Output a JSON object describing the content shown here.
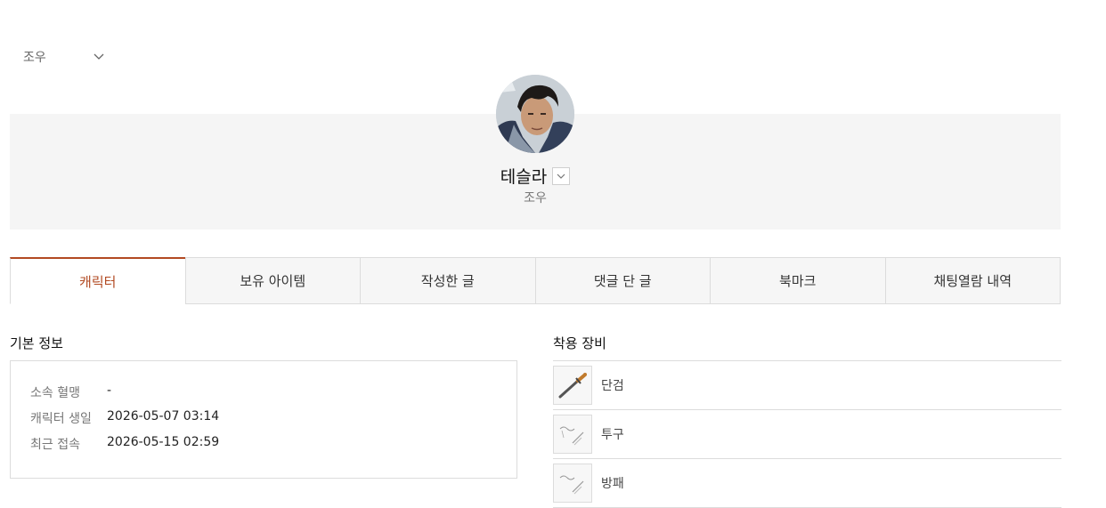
{
  "server_select": {
    "value": "조우"
  },
  "profile": {
    "name": "테슬라",
    "class": "조우"
  },
  "tabs": [
    {
      "label": "캐릭터",
      "active": true
    },
    {
      "label": "보유 아이템",
      "active": false
    },
    {
      "label": "작성한 글",
      "active": false
    },
    {
      "label": "댓글 단 글",
      "active": false
    },
    {
      "label": "북마크",
      "active": false
    },
    {
      "label": "채팅열람 내역",
      "active": false
    }
  ],
  "basic_info": {
    "title": "기본 정보",
    "rows": [
      {
        "label": "소속 혈맹",
        "value": "-"
      },
      {
        "label": "캐릭터 생일",
        "value": "2026-05-07 03:14"
      },
      {
        "label": "최근 접속",
        "value": "2026-05-15 02:59"
      }
    ]
  },
  "equipment": {
    "title": "착용 장비",
    "items": [
      {
        "name": "단검",
        "icon": "dagger-icon"
      },
      {
        "name": "투구",
        "icon": "placeholder-icon"
      },
      {
        "name": "방패",
        "icon": "placeholder-icon"
      }
    ]
  },
  "colors": {
    "accent": "#b24a22",
    "banner_bg": "#f5f5f5",
    "border": "#dcdcdc"
  }
}
